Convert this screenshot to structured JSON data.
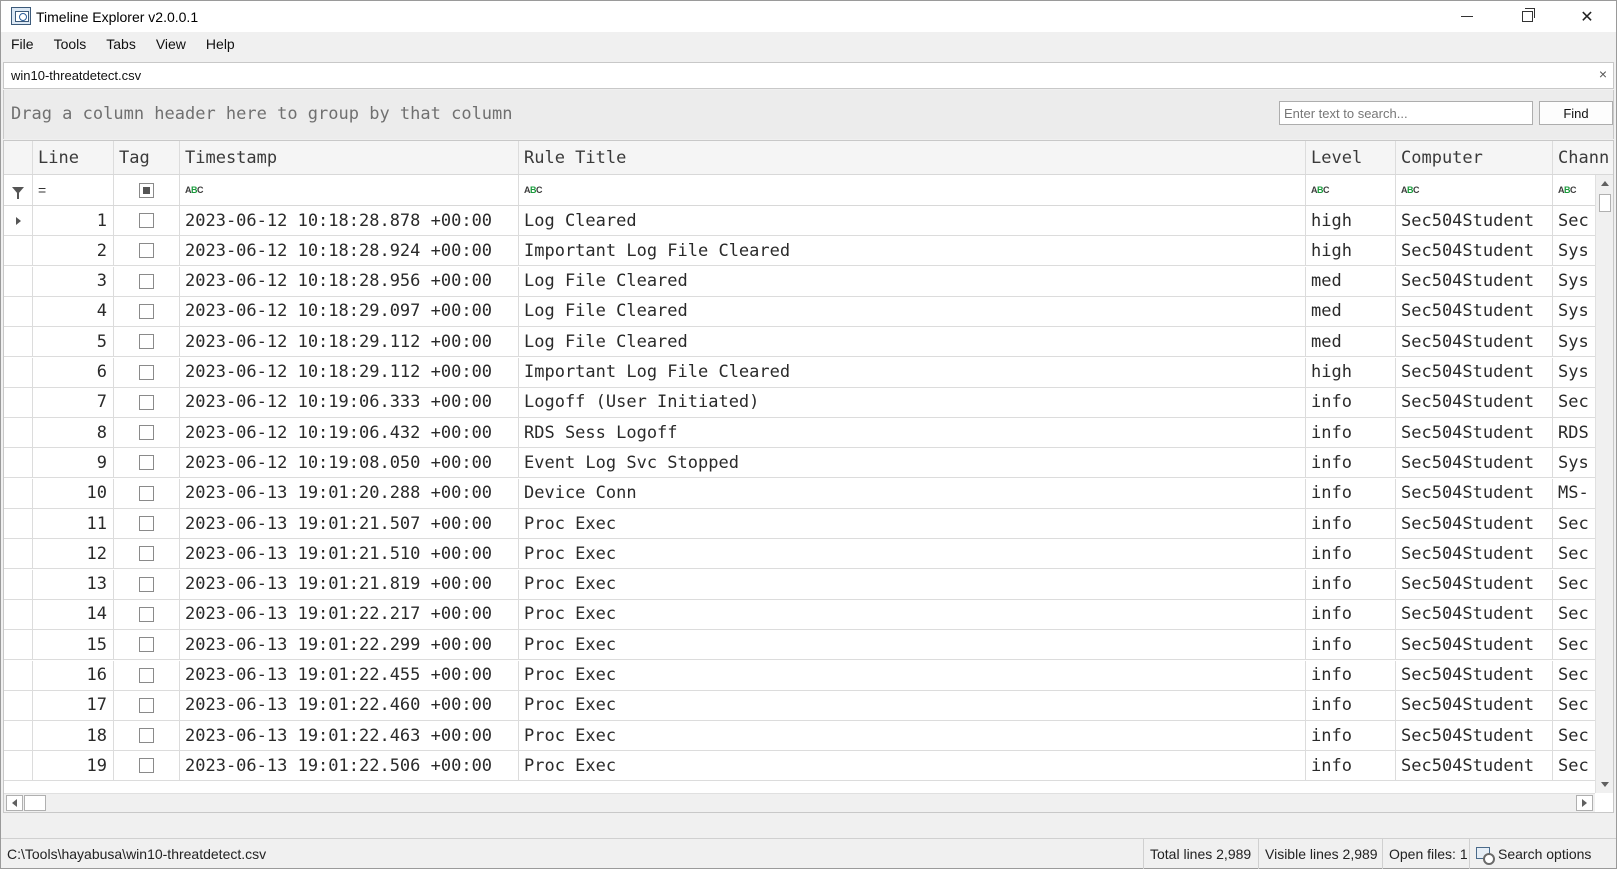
{
  "window": {
    "title": "Timeline Explorer v2.0.0.1"
  },
  "menu": {
    "items": [
      "File",
      "Tools",
      "Tabs",
      "View",
      "Help"
    ]
  },
  "tab": {
    "title": "win10-threatdetect.csv",
    "close": "×"
  },
  "group_panel": {
    "hint": "Drag a column header here to group by that column",
    "search_placeholder": "Enter text to search...",
    "find_label": "Find"
  },
  "grid": {
    "columns": [
      "Line",
      "Tag",
      "Timestamp",
      "Rule Title",
      "Level",
      "Computer",
      "Chann"
    ],
    "rows": [
      {
        "line": "1",
        "timestamp": "2023-06-12 10:18:28.878 +00:00",
        "rule": "Log Cleared",
        "level": "high",
        "computer": "Sec504Student",
        "channel": "Sec"
      },
      {
        "line": "2",
        "timestamp": "2023-06-12 10:18:28.924 +00:00",
        "rule": "Important Log File Cleared",
        "level": "high",
        "computer": "Sec504Student",
        "channel": "Sys"
      },
      {
        "line": "3",
        "timestamp": "2023-06-12 10:18:28.956 +00:00",
        "rule": "Log File Cleared",
        "level": "med",
        "computer": "Sec504Student",
        "channel": "Sys"
      },
      {
        "line": "4",
        "timestamp": "2023-06-12 10:18:29.097 +00:00",
        "rule": "Log File Cleared",
        "level": "med",
        "computer": "Sec504Student",
        "channel": "Sys"
      },
      {
        "line": "5",
        "timestamp": "2023-06-12 10:18:29.112 +00:00",
        "rule": "Log File Cleared",
        "level": "med",
        "computer": "Sec504Student",
        "channel": "Sys"
      },
      {
        "line": "6",
        "timestamp": "2023-06-12 10:18:29.112 +00:00",
        "rule": "Important Log File Cleared",
        "level": "high",
        "computer": "Sec504Student",
        "channel": "Sys"
      },
      {
        "line": "7",
        "timestamp": "2023-06-12 10:19:06.333 +00:00",
        "rule": "Logoff (User Initiated)",
        "level": "info",
        "computer": "Sec504Student",
        "channel": "Sec"
      },
      {
        "line": "8",
        "timestamp": "2023-06-12 10:19:06.432 +00:00",
        "rule": "RDS Sess Logoff",
        "level": "info",
        "computer": "Sec504Student",
        "channel": "RDS"
      },
      {
        "line": "9",
        "timestamp": "2023-06-12 10:19:08.050 +00:00",
        "rule": "Event Log Svc Stopped",
        "level": "info",
        "computer": "Sec504Student",
        "channel": "Sys"
      },
      {
        "line": "10",
        "timestamp": "2023-06-13 19:01:20.288 +00:00",
        "rule": "Device Conn",
        "level": "info",
        "computer": "Sec504Student",
        "channel": "MS-"
      },
      {
        "line": "11",
        "timestamp": "2023-06-13 19:01:21.507 +00:00",
        "rule": "Proc Exec",
        "level": "info",
        "computer": "Sec504Student",
        "channel": "Sec"
      },
      {
        "line": "12",
        "timestamp": "2023-06-13 19:01:21.510 +00:00",
        "rule": "Proc Exec",
        "level": "info",
        "computer": "Sec504Student",
        "channel": "Sec"
      },
      {
        "line": "13",
        "timestamp": "2023-06-13 19:01:21.819 +00:00",
        "rule": "Proc Exec",
        "level": "info",
        "computer": "Sec504Student",
        "channel": "Sec"
      },
      {
        "line": "14",
        "timestamp": "2023-06-13 19:01:22.217 +00:00",
        "rule": "Proc Exec",
        "level": "info",
        "computer": "Sec504Student",
        "channel": "Sec"
      },
      {
        "line": "15",
        "timestamp": "2023-06-13 19:01:22.299 +00:00",
        "rule": "Proc Exec",
        "level": "info",
        "computer": "Sec504Student",
        "channel": "Sec"
      },
      {
        "line": "16",
        "timestamp": "2023-06-13 19:01:22.455 +00:00",
        "rule": "Proc Exec",
        "level": "info",
        "computer": "Sec504Student",
        "channel": "Sec"
      },
      {
        "line": "17",
        "timestamp": "2023-06-13 19:01:22.460 +00:00",
        "rule": "Proc Exec",
        "level": "info",
        "computer": "Sec504Student",
        "channel": "Sec"
      },
      {
        "line": "18",
        "timestamp": "2023-06-13 19:01:22.463 +00:00",
        "rule": "Proc Exec",
        "level": "info",
        "computer": "Sec504Student",
        "channel": "Sec"
      },
      {
        "line": "19",
        "timestamp": "2023-06-13 19:01:22.506 +00:00",
        "rule": "Proc Exec",
        "level": "info",
        "computer": "Sec504Student",
        "channel": "Sec"
      }
    ]
  },
  "status": {
    "path": "C:\\Tools\\hayabusa\\win10-threatdetect.csv",
    "total_lines": "Total lines 2,989",
    "visible_lines": "Visible lines 2,989",
    "open_files": "Open files: 1",
    "search_options": "Search options"
  }
}
